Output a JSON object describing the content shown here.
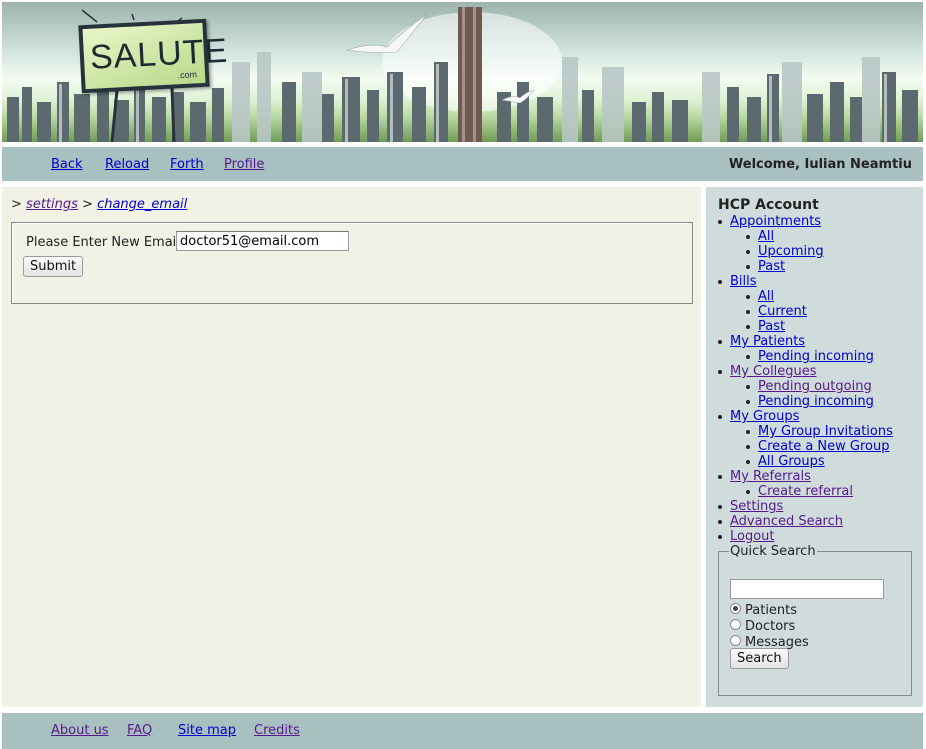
{
  "logo": {
    "text": "SALUTE",
    "sub": ".com"
  },
  "topnav": {
    "back": "Back",
    "reload": "Reload",
    "forth": "Forth",
    "profile": "Profile",
    "welcome": "Welcome, Iulian Neamtiu"
  },
  "breadcrumb": {
    "sep1": ">",
    "settings": "settings",
    "sep2": ">",
    "change_email": "change_email"
  },
  "form": {
    "label": "Please Enter New Email:",
    "email_value": "doctor51@email.com",
    "submit": "Submit"
  },
  "sidebar": {
    "title": "HCP Account",
    "menu": [
      {
        "label": "Appointments",
        "level": 1
      },
      {
        "label": "All",
        "level": 2
      },
      {
        "label": "Upcoming",
        "level": 2
      },
      {
        "label": "Past",
        "level": 2
      },
      {
        "label": "Bills",
        "level": 1
      },
      {
        "label": "All",
        "level": 2
      },
      {
        "label": "Current",
        "level": 2
      },
      {
        "label": "Past",
        "level": 2
      },
      {
        "label": "My Patients",
        "level": 1
      },
      {
        "label": "Pending incoming",
        "level": 2
      },
      {
        "label": "My Collegues",
        "level": 1
      },
      {
        "label": "Pending outgoing",
        "level": 2
      },
      {
        "label": "Pending incoming",
        "level": 2
      },
      {
        "label": "My Groups",
        "level": 1
      },
      {
        "label": "My Group Invitations",
        "level": 2
      },
      {
        "label": "Create a New Group",
        "level": 2
      },
      {
        "label": "All Groups",
        "level": 2
      },
      {
        "label": "My Referrals",
        "level": 1
      },
      {
        "label": "Create referral",
        "level": 2
      },
      {
        "label": "Settings",
        "level": 1
      },
      {
        "label": "Advanced Search",
        "level": 1
      },
      {
        "label": "Logout",
        "level": 1
      }
    ],
    "quick_search": {
      "legend": "Quick Search",
      "input_value": "",
      "options": [
        "Patients",
        "Doctors",
        "Messages"
      ],
      "selected": "Patients",
      "button": "Search"
    }
  },
  "footer": {
    "about": "About us",
    "faq": "FAQ",
    "sitemap": "Site map",
    "credits": "Credits"
  },
  "colors": {
    "nav_bar": "#a8c0bf",
    "main_bg": "#f1f1e6",
    "sidebar_bg": "#d0dcdc",
    "link": "#0000cc",
    "visited_link": "#551a8b"
  }
}
